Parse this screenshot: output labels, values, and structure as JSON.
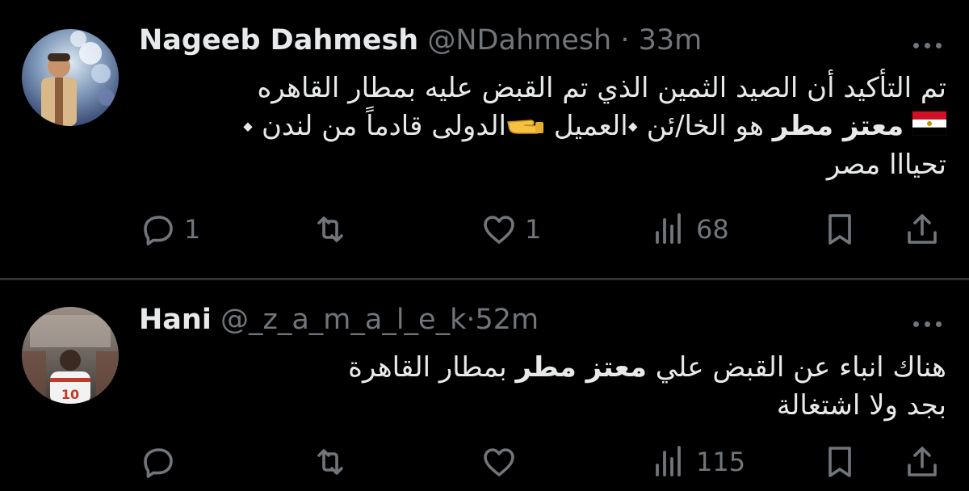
{
  "tweets": [
    {
      "name": "Nageeb Dahmesh",
      "handle": "@NDahmesh",
      "separator": "·",
      "time": "33m",
      "lines": [
        "تم التأكيد أن الصيد الثمين الذي تم القبض عليه بمطار القاهره",
        {
          "pre": "الدولى قادماً من لندن ⬩",
          "mid": " هو الخا/ئن ⬩العميل ",
          "bold": "معتز مطر"
        },
        "تحيااا مصر"
      ],
      "actions": {
        "reply_count": "1",
        "retweet_count": "",
        "like_count": "1",
        "views_count": "68"
      }
    },
    {
      "name": "Hani",
      "handle": "@_z_a_m_a_l_e_k",
      "separator": "·",
      "time": "52m",
      "lines": [
        {
          "pre": "هناك انباء عن القبض علي ",
          "bold": "معتز مطر",
          "post": " بمطار القاهرة"
        },
        "بجد ولا اشتغالة"
      ],
      "actions": {
        "views_count": "115"
      }
    }
  ],
  "colors": {
    "background": "#000000",
    "text": "#e7e9ea",
    "secondary": "#71767b",
    "divider": "#2f3336"
  },
  "icons": [
    "reply-icon",
    "retweet-icon",
    "like-icon",
    "views-icon",
    "bookmark-icon",
    "share-icon",
    "more-icon",
    "egypt-flag-icon",
    "pointing-hand-icon"
  ]
}
